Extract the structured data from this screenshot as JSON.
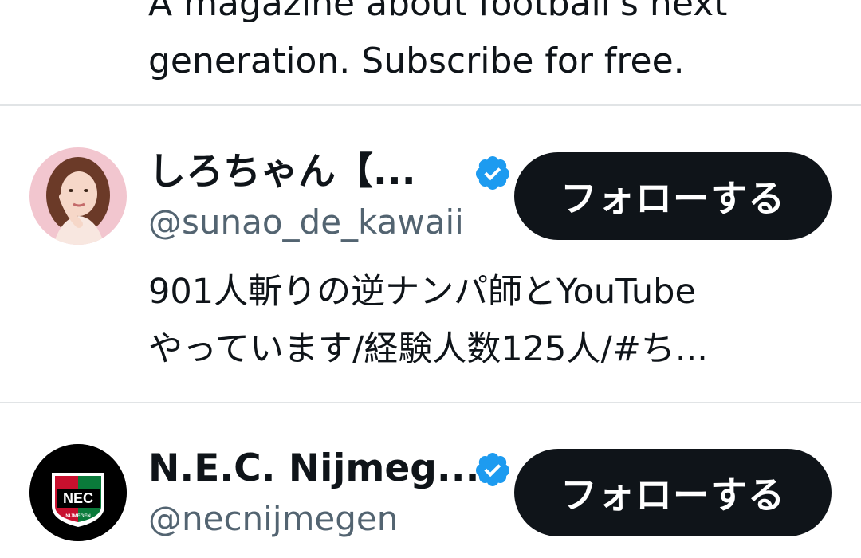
{
  "top_bio": {
    "line1": "A magazine about football's next",
    "line2": "generation. Subscribe for free."
  },
  "accounts": [
    {
      "name": "しろちゃん【...",
      "handle": "@sunao_de_kawaii",
      "follow_label": "フォローする",
      "bio_line1": "901人斬りの逆ナンパ師とYouTube",
      "bio_line2": "やっています/経験人数125人/#ち...",
      "verified": true
    },
    {
      "name": "N.E.C. Nijmeg...",
      "handle": "@necnijmegen",
      "follow_label": "フォローする",
      "verified": true,
      "logo_text": "NEC",
      "logo_subtext": "NIJMEGEN"
    }
  ],
  "colors": {
    "verified_blue": "#1d9bf0",
    "button_bg": "#0f1419",
    "handle_gray": "#536471",
    "divider": "#e1e4e6"
  }
}
